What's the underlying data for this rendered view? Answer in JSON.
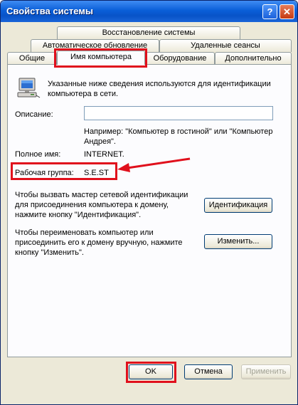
{
  "window": {
    "title": "Свойства системы",
    "help_label": "?",
    "close_label": "✕"
  },
  "tabs": {
    "row1": [
      "Восстановление системы"
    ],
    "row2": [
      "Автоматическое обновление",
      "Удаленные сеансы"
    ],
    "row3": [
      "Общие",
      "Имя компьютера",
      "Оборудование",
      "Дополнительно"
    ],
    "active": "Имя компьютера"
  },
  "computer_name": {
    "intro": "Указанные ниже сведения используются для идентификации компьютера в сети.",
    "description_label": "Описание:",
    "description_value": "",
    "example": "Например: \"Компьютер в гостиной\" или \"Компьютер Андрея\".",
    "full_name_label": "Полное имя:",
    "full_name_value": "INTERNET.",
    "workgroup_label": "Рабочая группа:",
    "workgroup_value": "S.E.ST",
    "network_id_text": "Чтобы вызвать мастер сетевой идентификации для присоединения компьютера к домену, нажмите кнопку \"Идентификация\".",
    "network_id_button": "Идентификация",
    "rename_text": "Чтобы переименовать компьютер или присоединить его к домену вручную, нажмите кнопку \"Изменить\".",
    "rename_button": "Изменить..."
  },
  "footer": {
    "ok": "OK",
    "cancel": "Отмена",
    "apply": "Применить"
  },
  "colors": {
    "annotation_red": "#e0101c",
    "titlebar_blue": "#0a5fd8"
  }
}
